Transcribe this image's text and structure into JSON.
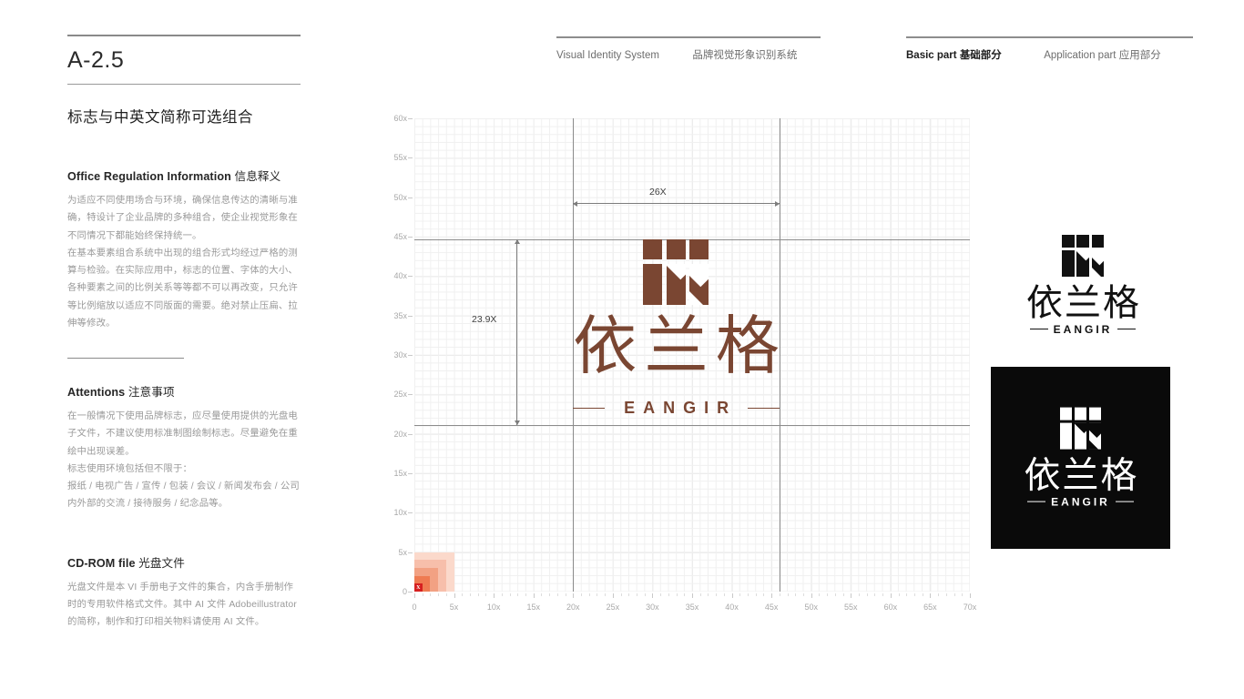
{
  "left": {
    "section_code": "A-2.5",
    "section_title": "标志与中英文简称可选组合",
    "blocks": [
      {
        "heading_en": "Office Regulation Information",
        "heading_cn": " 信息释义",
        "paragraphs": [
          "为适应不同使用场合与环境，确保信息传达的清晰与准确，特设计了企业品牌的多种组合，使企业视觉形象在不同情况下都能始终保持统一。",
          "在基本要素组合系统中出现的组合形式均经过严格的测算与检验。在实际应用中，标志的位置、字体的大小、各种要素之间的比例关系等等都不可以再改变，只允许等比例缩放以适应不同版面的需要。绝对禁止压扁、拉伸等修改。"
        ]
      },
      {
        "heading_en": "Attentions",
        "heading_cn": " 注意事项",
        "paragraphs": [
          "在一般情况下使用品牌标志，应尽量使用提供的光盘电子文件，不建议使用标准制图绘制标志。尽量避免在重绘中出现误差。",
          "标志使用环境包括但不限于：",
          "报纸 / 电视广告 / 宣传 / 包装 / 会议 / 新闻发布会 / 公司内外部的交流 / 接待服务 / 纪念品等。"
        ]
      },
      {
        "heading_en": "CD-ROM file",
        "heading_cn": " 光盘文件",
        "paragraphs": [
          "光盘文件是本 VI 手册电子文件的集合，内含手册制作时的专用软件格式文件。其中 AI 文件 Adobeillustrator 的简称，制作和打印相关物料请使用 AI 文件。"
        ]
      }
    ]
  },
  "header": {
    "group_left": [
      {
        "label": "Visual Identity System",
        "active": false
      },
      {
        "label": "品牌视觉形象识别系统",
        "active": false
      }
    ],
    "group_right": [
      {
        "label": "Basic part",
        "cn": "基础部分",
        "active": true
      },
      {
        "label": "Application part",
        "cn": "应用部分",
        "active": false
      }
    ]
  },
  "chart_data": {
    "type": "grid",
    "title": "",
    "xlabel": "",
    "ylabel": "",
    "xlim": [
      0,
      70
    ],
    "ylim": [
      0,
      60
    ],
    "x_tick_labels": [
      "0",
      "5x",
      "10x",
      "15x",
      "20x",
      "25x",
      "30x",
      "35x",
      "40x",
      "45x",
      "50x",
      "55x",
      "60x",
      "65x",
      "70x"
    ],
    "x_tick_values": [
      0,
      5,
      10,
      15,
      20,
      25,
      30,
      35,
      40,
      45,
      50,
      55,
      60,
      65,
      70
    ],
    "y_tick_labels": [
      "0",
      "5x",
      "10x",
      "15x",
      "20x",
      "25x",
      "30x",
      "35x",
      "40x",
      "45x",
      "50x",
      "55x",
      "60x"
    ],
    "y_tick_values": [
      0,
      5,
      10,
      15,
      20,
      25,
      30,
      35,
      40,
      45,
      50,
      55,
      60
    ],
    "grid": true,
    "minor_grid_step": 1,
    "major_grid_step": 5,
    "guides_vertical": [
      20,
      46
    ],
    "guides_horizontal": [
      21,
      44.5
    ],
    "annotations": [
      {
        "label": "26X",
        "orientation": "horizontal",
        "from": 20,
        "to": 46,
        "at": 50
      },
      {
        "label": "23.9X",
        "orientation": "vertical",
        "from": 21,
        "to": 44.5,
        "at": 20
      }
    ],
    "unit_swatch": {
      "label": "X",
      "steps": [
        1,
        2,
        3,
        4,
        5
      ],
      "colors": [
        "#d62020",
        "#ef7b52",
        "#f2a183",
        "#f7bfab",
        "#fbd9cb"
      ]
    }
  },
  "logo": {
    "brand_cn": "依兰格",
    "brand_cn_chars": [
      "依",
      "兰",
      "格"
    ],
    "brand_en": "EANGIR",
    "mark_name": "eangir-grid-mark",
    "color_brown": "#7a4632",
    "color_black": "#0a0a0a",
    "color_white": "#ffffff"
  },
  "lockups": [
    {
      "name": "lockup-black-on-white",
      "variant": "light",
      "fg": "#111111",
      "bg": "#ffffff"
    },
    {
      "name": "lockup-white-on-black",
      "variant": "dark",
      "fg": "#ffffff",
      "bg": "#0a0a0a"
    }
  ]
}
